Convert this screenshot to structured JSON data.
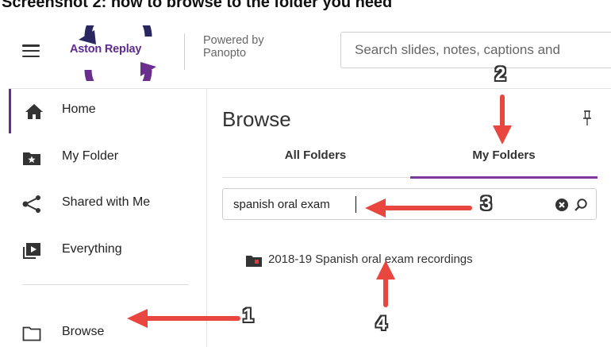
{
  "page_heading": "Screenshot 2: how to browse to the folder you need",
  "header": {
    "brand": "Aston Replay",
    "powered_by_line1": "Powered by",
    "powered_by_line2": "Panopto",
    "search_placeholder": "Search slides, notes, captions and"
  },
  "sidebar": {
    "items": [
      {
        "label": "Home",
        "icon": "home-icon"
      },
      {
        "label": "My Folder",
        "icon": "star-folder-icon"
      },
      {
        "label": "Shared with Me",
        "icon": "share-icon"
      },
      {
        "label": "Everything",
        "icon": "playlist-icon"
      },
      {
        "label": "Browse",
        "icon": "folder-outline-icon"
      }
    ]
  },
  "main": {
    "title": "Browse",
    "tabs": [
      {
        "label": "All Folders",
        "active": false
      },
      {
        "label": "My Folders",
        "active": true
      }
    ],
    "filter_value": "spanish oral exam",
    "results": [
      {
        "label": "2018-19 Spanish oral exam recordings",
        "icon": "folder-icon"
      }
    ]
  },
  "annotations": {
    "callouts": [
      "1",
      "2",
      "3",
      "4"
    ],
    "arrow_color": "#e8463f"
  },
  "colors": {
    "brand_purple": "#5e2b8f",
    "tab_accent": "#7d3a9a",
    "folder_red": "#e03a3a"
  }
}
